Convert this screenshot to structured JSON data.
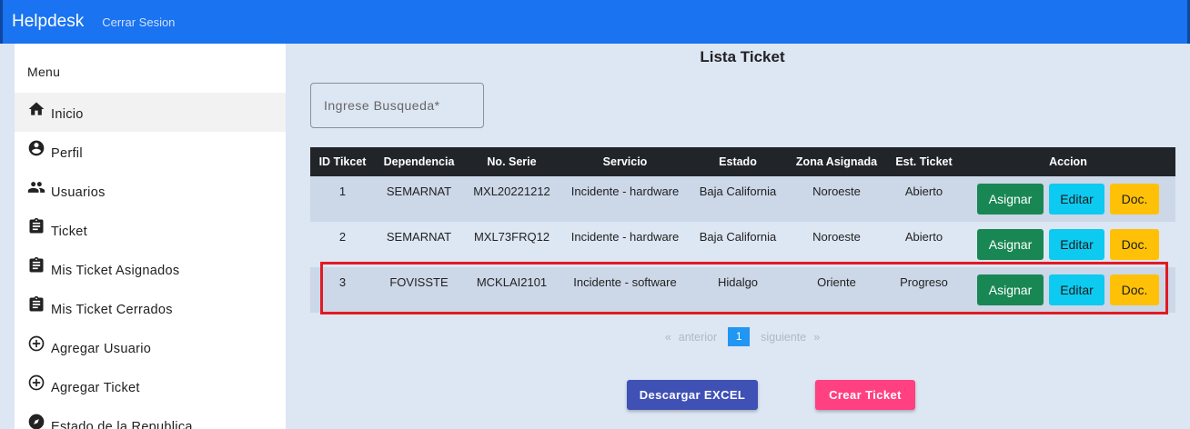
{
  "navbar": {
    "brand": "Helpdesk",
    "logout": "Cerrar Sesion"
  },
  "sidebar": {
    "title": "Menu",
    "items": [
      {
        "label": "Inicio",
        "icon": "home-icon"
      },
      {
        "label": "Perfil",
        "icon": "account-circle-icon"
      },
      {
        "label": "Usuarios",
        "icon": "people-icon"
      },
      {
        "label": "Ticket",
        "icon": "clipboard-icon"
      },
      {
        "label": "Mis Ticket Asignados",
        "icon": "clipboard-icon"
      },
      {
        "label": "Mis Ticket Cerrados",
        "icon": "clipboard-icon"
      },
      {
        "label": "Agregar Usuario",
        "icon": "add-circle-icon"
      },
      {
        "label": "Agregar Ticket",
        "icon": "add-circle-icon"
      },
      {
        "label": "Estado de la Republica",
        "icon": "compass-icon"
      }
    ]
  },
  "main": {
    "title": "Lista Ticket",
    "search_placeholder": "Ingrese Busqueda*",
    "table": {
      "headers": [
        "ID Tikcet",
        "Dependencia",
        "No. Serie",
        "Servicio",
        "Estado",
        "Zona Asignada",
        "Est. Ticket",
        "Accion"
      ],
      "rows": [
        [
          "1",
          "SEMARNAT",
          "MXL20221212",
          "Incidente - hardware",
          "Baja California",
          "Noroeste",
          "Abierto"
        ],
        [
          "2",
          "SEMARNAT",
          "MXL73FRQ12",
          "Incidente - hardware",
          "Baja California",
          "Noroeste",
          "Abierto"
        ],
        [
          "3",
          "FOVISSTE",
          "MCKLAI2101",
          "Incidente - software",
          "Hidalgo",
          "Oriente",
          "Progreso"
        ]
      ],
      "actions": {
        "assign": "Asignar",
        "edit": "Editar",
        "doc": "Doc."
      }
    },
    "pagination": {
      "first": "«",
      "prev": "anterior",
      "current": "1",
      "next": "siguiente",
      "last": "»"
    },
    "buttons": {
      "excel": "Descargar EXCEL",
      "create": "Crear Ticket"
    }
  },
  "colors": {
    "navbar": "#1a73f0",
    "background": "#dde6f3",
    "table_header": "#212529",
    "assign": "#198754",
    "edit": "#0dcaf0",
    "doc": "#ffc107",
    "excel": "#3f51b5",
    "create": "#ff4081",
    "highlight": "#e11b22"
  }
}
